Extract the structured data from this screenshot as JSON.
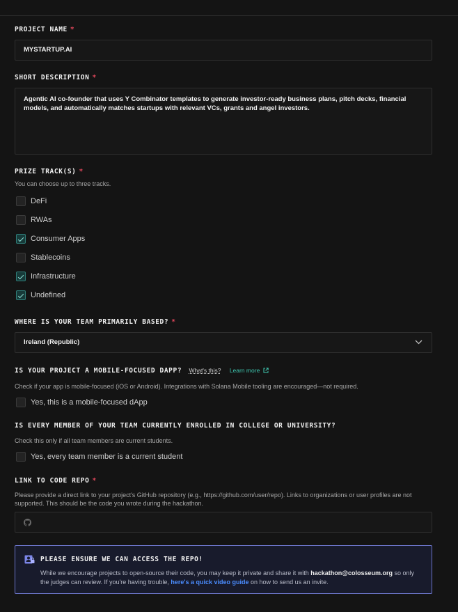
{
  "project_name": {
    "label": "PROJECT NAME",
    "required": "*",
    "value": "MYSTARTUP.AI"
  },
  "short_description": {
    "label": "SHORT DESCRIPTION",
    "required": "*",
    "value": "Agentic AI co-founder that uses Y Combinator templates to generate investor-ready business plans, pitch decks, financial models, and automatically matches startups with relevant VCs, grants and angel investors."
  },
  "prize_tracks": {
    "label": "PRIZE TRACK(S)",
    "required": "*",
    "hint": "You can choose up to three tracks.",
    "options": [
      {
        "label": "DeFi",
        "checked": false
      },
      {
        "label": "RWAs",
        "checked": false
      },
      {
        "label": "Consumer Apps",
        "checked": true
      },
      {
        "label": "Stablecoins",
        "checked": false
      },
      {
        "label": "Infrastructure",
        "checked": true
      },
      {
        "label": "Undefined",
        "checked": true
      }
    ]
  },
  "team_location": {
    "label": "WHERE IS YOUR TEAM PRIMARILY BASED?",
    "required": "*",
    "value": "Ireland (Republic)"
  },
  "mobile_dapp": {
    "label": "IS YOUR PROJECT A MOBILE-FOCUSED DAPP?",
    "whats_this": "What's this?",
    "learn_more": "Learn more",
    "hint": "Check if your app is mobile-focused (iOS or Android). Integrations with Solana Mobile tooling are encouraged—not required.",
    "checkbox_label": "Yes, this is a mobile-focused dApp",
    "checked": false
  },
  "students": {
    "label": "IS EVERY MEMBER OF YOUR TEAM CURRENTLY ENROLLED IN COLLEGE OR UNIVERSITY?",
    "hint": "Check this only if all team members are current students.",
    "checkbox_label": "Yes, every team member is a current student",
    "checked": false
  },
  "code_repo": {
    "label": "LINK TO CODE REPO",
    "required": "*",
    "hint": "Please provide a direct link to your project's GitHub repository (e.g., https://github.com/user/repo). Links to organizations or user profiles are not supported. This should be the code you wrote during the hackathon.",
    "value": "",
    "icon": "github-icon"
  },
  "notice": {
    "title": "PLEASE ENSURE WE CAN ACCESS THE REPO!",
    "body_1": "While we encourage projects to open-source their code, you may keep it private and share it with ",
    "email": "hackathon@colosseum.org",
    "body_2": " so only the judges can review. If you're having trouble, ",
    "link": "here's a quick video guide",
    "body_3": " on how to send us an invite.",
    "icon": "user-lock-icon"
  },
  "colors": {
    "background": "#141414",
    "required": "#e0475b",
    "accent_teal": "#3fc7b0",
    "notice_border": "#6b74c8",
    "link_blue": "#4b8dff"
  }
}
